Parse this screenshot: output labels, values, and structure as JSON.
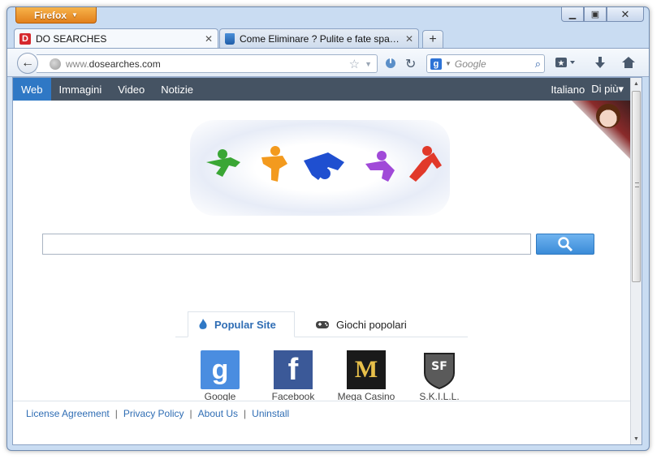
{
  "browser": {
    "app_button": "Firefox",
    "tabs": [
      {
        "title": "DO SEARCHES",
        "favicon": "D"
      },
      {
        "title": "Come Eliminare ? Pulite e fate spazio ...",
        "favicon": "recycle-bin"
      }
    ],
    "url": {
      "prefix": "www.",
      "domain": "dosearches.com"
    },
    "search": {
      "engine": "g",
      "placeholder": "Google"
    }
  },
  "page": {
    "menu": {
      "items": [
        "Web",
        "Immagini",
        "Video",
        "Notizie"
      ],
      "active": "Web",
      "language": "Italiano",
      "more": "Di più▾"
    },
    "search_query": "",
    "popular_tabs": [
      "Popular Site",
      "Giochi popolari"
    ],
    "sites": [
      {
        "label": "Google",
        "icon_text": "g"
      },
      {
        "label": "Facebook",
        "icon_text": "f"
      },
      {
        "label": "Mega Casino",
        "icon_text": "M"
      },
      {
        "label": "S.K.I.L.L.",
        "icon_text": "SF"
      }
    ],
    "footer": [
      "License Agreement",
      "Privacy Policy",
      "About Us",
      "Uninstall"
    ],
    "colors": {
      "accent": "#2f78c5",
      "menubar": "#455363",
      "firefox_orange": "#e2801c"
    }
  }
}
